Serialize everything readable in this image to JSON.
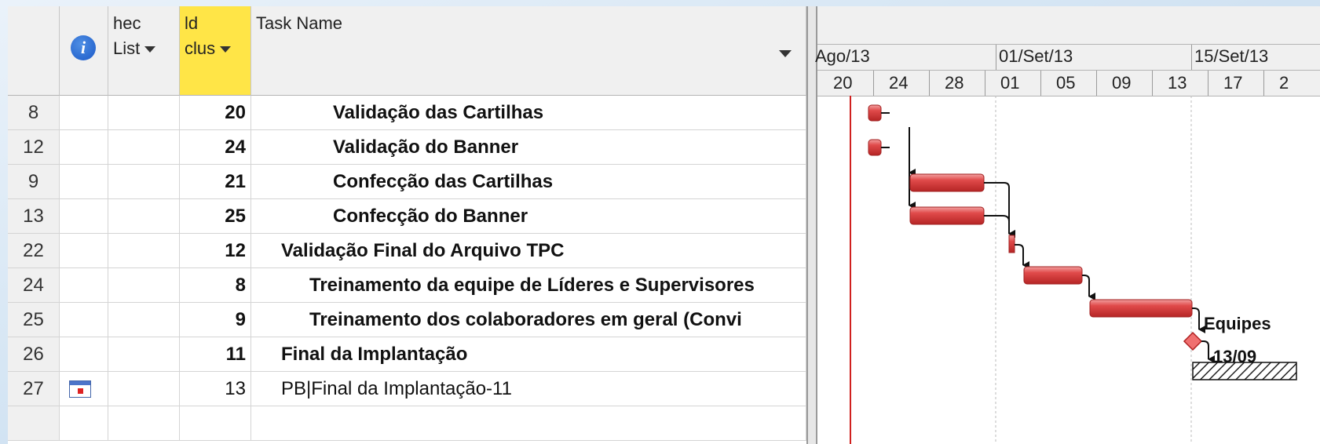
{
  "columns": {
    "check_line1": "hec",
    "check_line2": "List",
    "id_line1": "ld",
    "id_line2": "clus",
    "task_name": "Task Name"
  },
  "rows": [
    {
      "row": "8",
      "id": "20",
      "name": "Validação das Cartilhas"
    },
    {
      "row": "12",
      "id": "24",
      "name": "Validação do Banner"
    },
    {
      "row": "9",
      "id": "21",
      "name": "Confecção das Cartilhas"
    },
    {
      "row": "13",
      "id": "25",
      "name": "Confecção do Banner"
    },
    {
      "row": "22",
      "id": "12",
      "name": "Validação Final do Arquivo TPC"
    },
    {
      "row": "24",
      "id": "8",
      "name": "Treinamento da equipe de Líderes e Supervisores"
    },
    {
      "row": "25",
      "id": "9",
      "name": "Treinamento dos colaboradores em geral (Convi"
    },
    {
      "row": "26",
      "id": "11",
      "name": "Final da Implantação"
    },
    {
      "row": "27",
      "id": "13",
      "name": "PB|Final da Implantação-11"
    }
  ],
  "timeline": {
    "periods": [
      "Ago/13",
      "01/Set/13",
      "15/Set/13"
    ],
    "days": [
      "20",
      "24",
      "28",
      "01",
      "05",
      "09",
      "13",
      "17",
      "2"
    ],
    "bar_labels": {
      "equipes": "Equipes",
      "milestone_date": "13/09"
    }
  },
  "colors": {
    "bar": "#e04a4a",
    "today_line": "#d0201f",
    "id_header": "#ffe547"
  }
}
